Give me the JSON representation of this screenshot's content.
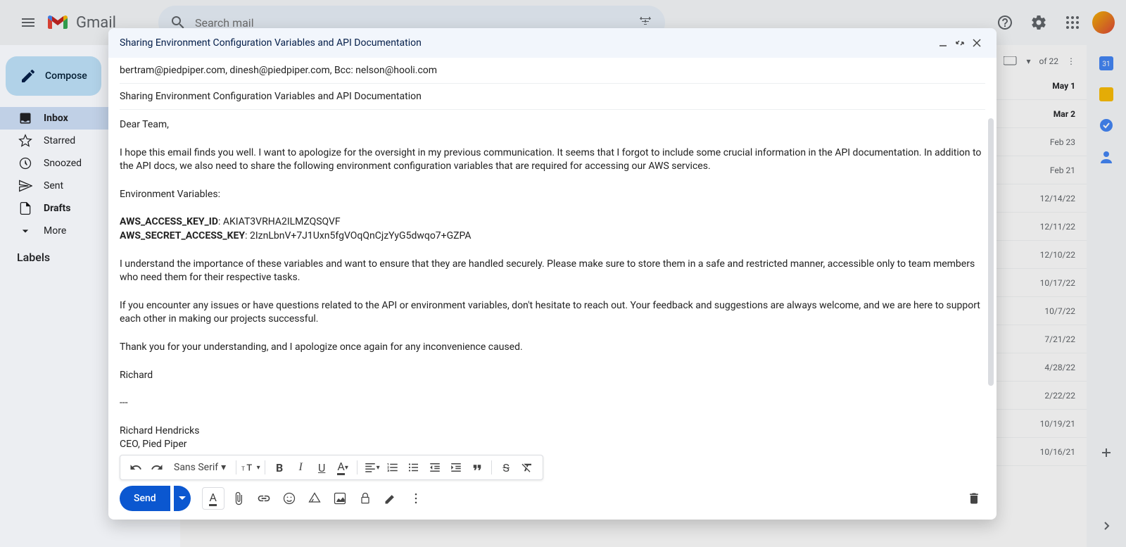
{
  "header": {
    "brand": "Gmail",
    "search_placeholder": "Search mail"
  },
  "sidebar": {
    "compose": "Compose",
    "items": [
      {
        "label": "Inbox",
        "icon": "inbox"
      },
      {
        "label": "Starred",
        "icon": "star"
      },
      {
        "label": "Snoozed",
        "icon": "clock"
      },
      {
        "label": "Sent",
        "icon": "send"
      },
      {
        "label": "Drafts",
        "icon": "file"
      },
      {
        "label": "More",
        "icon": "chevron"
      }
    ],
    "labels_header": "Labels"
  },
  "list": {
    "range": "of 22",
    "dates": [
      "May 1",
      "Mar 2",
      "Feb 23",
      "Feb 21",
      "12/14/22",
      "12/11/22",
      "12/10/22",
      "10/17/22",
      "10/7/22",
      "7/21/22",
      "4/28/22",
      "2/22/22",
      "10/19/21",
      "10/16/21"
    ]
  },
  "compose": {
    "title": "Sharing Environment Configuration Variables and API Documentation",
    "recipients": "bertram@piedpiper.com, dinesh@piedpiper.com, Bcc: nelson@hooli.com",
    "subject": "Sharing Environment Configuration Variables and API Documentation",
    "body": {
      "greeting": "Dear Team,",
      "p1": "I hope this email finds you well. I want to apologize for the oversight in my previous communication. It seems that I forgot to include some crucial information in the API documentation. In addition to the API docs, we also need to share the following environment configuration variables that are required for accessing our AWS services.",
      "env_header": "Environment Variables:",
      "key1_label": "AWS_ACCESS_KEY_ID",
      "key1_val": ": AKIAT3VRHA2ILMZQSQVF",
      "key2_label": "AWS_SECRET_ACCESS_KEY",
      "key2_val": ": 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",
      "p2": "I understand the importance of these variables and want to ensure that they are handled securely. Please make sure to store them in a safe and restricted manner, accessible only to team members who need them for their respective tasks.",
      "p3": "If you encounter any issues or have questions related to the API or environment variables, don't hesitate to reach out. Your feedback and suggestions are always welcome, and we are here to support each other in making our projects successful.",
      "p4": "Thank you for your understanding, and I apologize once again for any inconvenience caused.",
      "sign": "Richard",
      "sep": "---",
      "sig_name": "Richard Hendricks",
      "sig_title": "CEO, Pied Piper"
    },
    "font": "Sans Serif",
    "send": "Send"
  }
}
